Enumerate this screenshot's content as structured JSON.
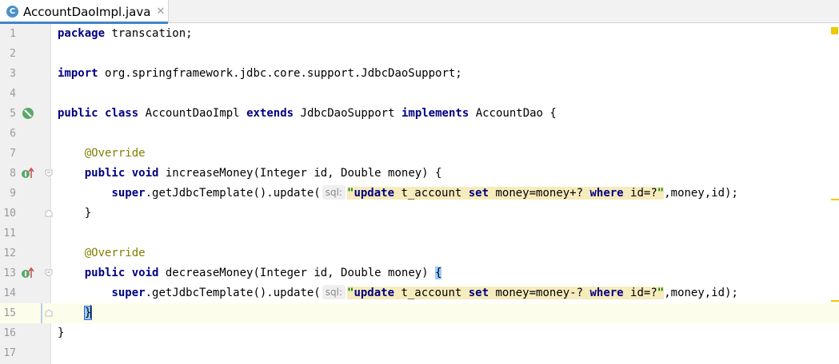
{
  "tab": {
    "icon_letter": "C",
    "filename": "AccountDaoImpl.java",
    "close_glyph": "✕",
    "icon_color": "#4a90c8"
  },
  "hint_label": "sql:",
  "lines": [
    {
      "n": "1"
    },
    {
      "n": "2"
    },
    {
      "n": "3"
    },
    {
      "n": "4"
    },
    {
      "n": "5"
    },
    {
      "n": "6"
    },
    {
      "n": "7"
    },
    {
      "n": "8"
    },
    {
      "n": "9"
    },
    {
      "n": "10"
    },
    {
      "n": "11"
    },
    {
      "n": "12"
    },
    {
      "n": "13"
    },
    {
      "n": "14"
    },
    {
      "n": "15"
    },
    {
      "n": "16"
    },
    {
      "n": "17"
    }
  ],
  "code": {
    "l1_kw": "package",
    "l1_rest": " transcation;",
    "l3_kw": "import",
    "l3_rest": " org.springframework.jdbc.core.support.JdbcDaoSupport;",
    "l5_kw1": "public",
    "l5_kw2": "class",
    "l5_name": "AccountDaoImpl",
    "l5_kw3": "extends",
    "l5_super": "JdbcDaoSupport",
    "l5_kw4": "implements",
    "l5_iface": "AccountDao {",
    "override": "@Override",
    "l8_kw1": "public",
    "l8_kw2": "void",
    "l8_rest": " increaseMoney(Integer id, Double money) {",
    "call_kw": "super",
    "call_rest": ".getJdbcTemplate().update(",
    "sql_q": "\"",
    "sql_update": "update",
    "sql_table": " t_account ",
    "sql_set": "set",
    "sql_inc": " money=money+? ",
    "sql_dec": " money=money-? ",
    "sql_where": "where",
    "sql_id": " id=?",
    "call_tail": ",money,id);",
    "close_brace": "}",
    "l13_kw1": "public",
    "l13_kw2": "void",
    "l13_rest": " decreaseMoney(Integer id, Double money) ",
    "l13_brace": "{"
  }
}
